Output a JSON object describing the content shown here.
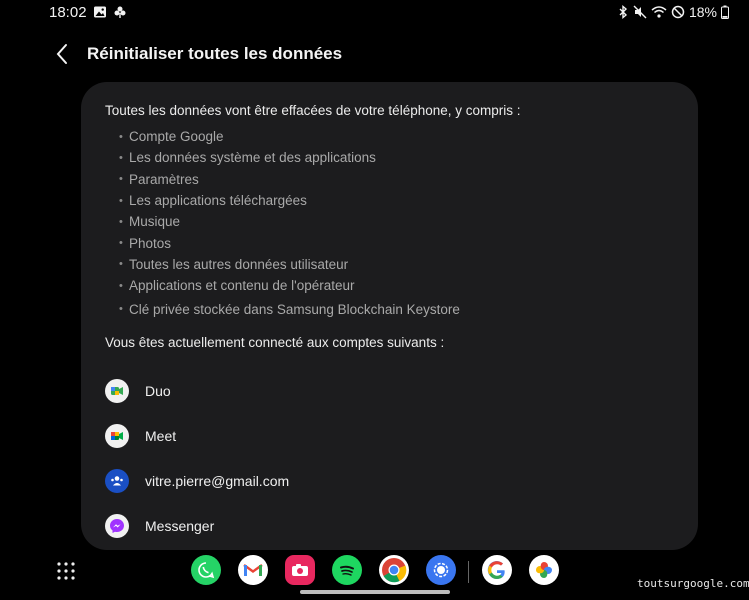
{
  "status_bar": {
    "time": "18:02",
    "battery": "18%",
    "left_icons": [
      "image-icon",
      "clover-icon"
    ],
    "right_icons": [
      "bluetooth-icon",
      "mute-icon",
      "wifi-icon",
      "do-not-disturb-icon",
      "battery-icon"
    ]
  },
  "header": {
    "title": "Réinitialiser toutes les données",
    "back_icon": "chevron-left-icon"
  },
  "card": {
    "intro": "Toutes les données vont être effacées de votre téléphone, y compris :",
    "items": [
      "Compte Google",
      "Les données système et des applications",
      "Paramètres",
      "Les applications téléchargées",
      "Musique",
      "Photos",
      "Toutes les autres données utilisateur",
      "Applications et contenu de l'opérateur",
      "Clé privée stockée dans Samsung Blockchain Keystore"
    ],
    "accounts_intro": "Vous êtes actuellement connecté aux comptes suivants :",
    "accounts": [
      {
        "label": "Duo",
        "icon": "duo-icon"
      },
      {
        "label": "Meet",
        "icon": "meet-icon"
      },
      {
        "label": "vitre.pierre@gmail.com",
        "icon": "samsung-account-icon"
      },
      {
        "label": "Messenger",
        "icon": "messenger-icon"
      }
    ]
  },
  "dock": {
    "apps": [
      "whatsapp-icon",
      "gmail-icon",
      "camera-icon",
      "spotify-icon",
      "chrome-icon",
      "signal-icon",
      "google-icon",
      "google-photos-icon"
    ]
  },
  "watermark": "toutsurgoogle.com",
  "colors": {
    "background": "#000000",
    "card": "#1c1c1e",
    "primary_text": "#ececec",
    "secondary_text": "#a9a9a9"
  }
}
